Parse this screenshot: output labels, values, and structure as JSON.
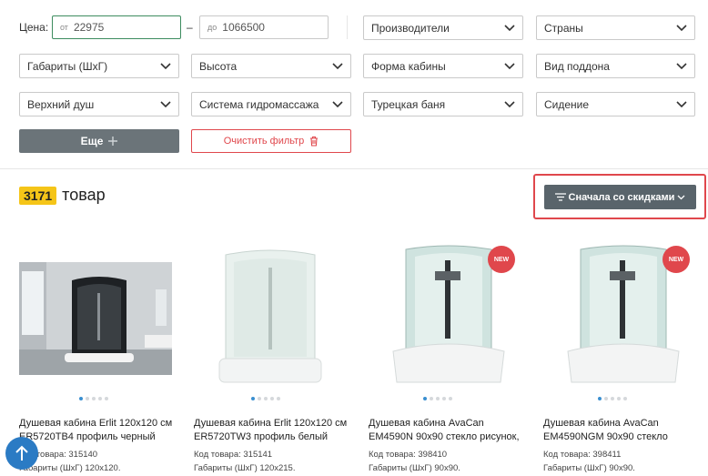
{
  "filters": {
    "price_label": "Цена:",
    "price_from_prefix": "от",
    "price_from_value": "22975",
    "price_dash": "–",
    "price_to_prefix": "до",
    "price_to_value": "1066500",
    "selects": [
      "Производители",
      "Страны",
      "Габариты (ШхГ)",
      "Высота",
      "Форма кабины",
      "Вид поддона",
      "Верхний душ",
      "Система гидромассажа",
      "Турецкая баня",
      "Сидение"
    ],
    "more_label": "Еще",
    "clear_label": "Очистить фильтр"
  },
  "results": {
    "count": "3171",
    "unit": "товар",
    "sort_label": "Сначала со скидками"
  },
  "products": [
    {
      "title1": "Душевая кабина Erlit 120x120 см",
      "title2": "ER5720TB4 профиль черный",
      "code": "Код товара: 315140",
      "dims": "Габариты (ШхГ) 120x120.",
      "is_new": false
    },
    {
      "title1": "Душевая кабина Erlit 120x120 см",
      "title2": "ER5720TW3 профиль белый",
      "code": "Код товара: 315141",
      "dims": "Габариты (ШхГ) 120x215.",
      "is_new": false
    },
    {
      "title1": "Душевая кабина AvaCan",
      "title2": "EM4590N 90x90 стекло рисунок,",
      "code": "Код товара: 398410",
      "dims": "Габариты (ШхГ) 90x90.",
      "is_new": true
    },
    {
      "title1": "Душевая кабина AvaCan",
      "title2": "EM4590NGM 90x90 стекло",
      "code": "Код товара: 398411",
      "dims": "Габариты (ШхГ) 90x90.",
      "is_new": true
    }
  ],
  "badge_new": "NEW",
  "colors": {
    "accent_green": "#3d8c5f",
    "red": "#e0474c",
    "badge_yellow": "#f5c518",
    "up_blue": "#2b7bc4"
  }
}
